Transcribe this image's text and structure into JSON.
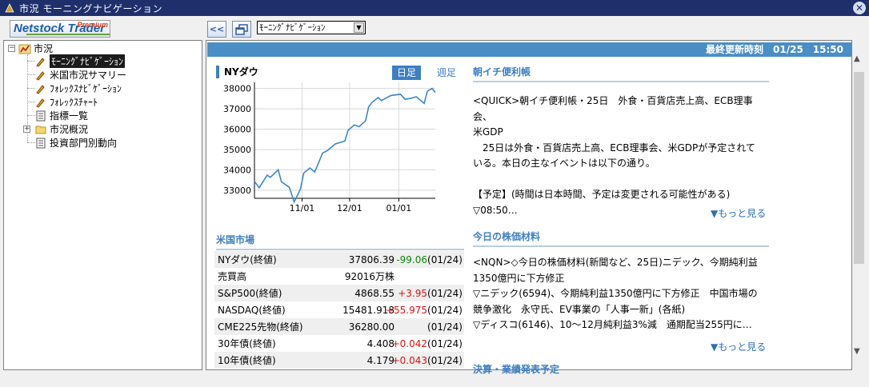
{
  "window": {
    "title": "市況 モーニングナビゲーション"
  },
  "logo": {
    "text": "Netstock Trader",
    "badge": "Premium"
  },
  "toolbar": {
    "back_label": "<<",
    "page_select": "ﾓｰﾆﾝｸﾞﾅﾋﾞｹﾞｰｼｮﾝ"
  },
  "tree": {
    "root": "市況",
    "items": [
      {
        "label": "ﾓｰﾆﾝｸﾞﾅﾋﾞｹﾞｰｼｮﾝ"
      },
      {
        "label": "米国市況サマリー"
      },
      {
        "label": "ﾌｫﾚｯｸｽﾅﾋﾞｹﾞｰｼｮﾝ"
      },
      {
        "label": "ﾌｫﾚｯｸｽﾁｬｰﾄ"
      },
      {
        "label": "指標一覧"
      },
      {
        "label": "市況概況"
      },
      {
        "label": "投資部門別動向"
      }
    ]
  },
  "header": {
    "label": "最終更新時刻",
    "date": "01/25",
    "time": "15:50"
  },
  "chart_panel": {
    "title": "NYダウ",
    "tab_day": "日足",
    "tab_week": "週足"
  },
  "chart_data": {
    "type": "line",
    "title": "NYダウ",
    "xlabel": "",
    "ylabel": "",
    "y_ticks": [
      "38000",
      "37000",
      "36000",
      "35000",
      "34000",
      "33000"
    ],
    "x_ticks": [
      "11/01",
      "12/01",
      "01/01"
    ],
    "ylim": [
      32600,
      38300
    ],
    "x_range": [
      "2023-10-02",
      "2024-01-24"
    ],
    "grid": true,
    "series": [
      {
        "values": [
          [
            "2023-10-02",
            33434
          ],
          [
            "2023-10-05",
            33120
          ],
          [
            "2023-10-10",
            33740
          ],
          [
            "2023-10-12",
            33630
          ],
          [
            "2023-10-17",
            33998
          ],
          [
            "2023-10-19",
            33415
          ],
          [
            "2023-10-24",
            33140
          ],
          [
            "2023-10-27",
            32418
          ],
          [
            "2023-10-31",
            33052
          ],
          [
            "2023-11-02",
            33840
          ],
          [
            "2023-11-06",
            34095
          ],
          [
            "2023-11-09",
            33890
          ],
          [
            "2023-11-14",
            34828
          ],
          [
            "2023-11-17",
            34947
          ],
          [
            "2023-11-22",
            35273
          ],
          [
            "2023-11-28",
            35416
          ],
          [
            "2023-11-30",
            35950
          ],
          [
            "2023-12-04",
            36204
          ],
          [
            "2023-12-07",
            36117
          ],
          [
            "2023-12-11",
            36404
          ],
          [
            "2023-12-13",
            37090
          ],
          [
            "2023-12-15",
            37305
          ],
          [
            "2023-12-19",
            37557
          ],
          [
            "2023-12-21",
            37404
          ],
          [
            "2023-12-27",
            37656
          ],
          [
            "2024-01-02",
            37715
          ],
          [
            "2024-01-05",
            37466
          ],
          [
            "2024-01-09",
            37525
          ],
          [
            "2024-01-12",
            37592
          ],
          [
            "2024-01-17",
            37266
          ],
          [
            "2024-01-19",
            37863
          ],
          [
            "2024-01-22",
            38001
          ],
          [
            "2024-01-24",
            37806
          ]
        ]
      }
    ]
  },
  "us_market": {
    "title": "米国市場",
    "rows": [
      {
        "name": "NYダウ(終値)",
        "value": "37806.39",
        "change": "-99.06",
        "dir": "down",
        "date": "(01/24)"
      },
      {
        "name": "売買高",
        "value": "92016万株",
        "change": "",
        "dir": "",
        "date": ""
      },
      {
        "name": "S&P500(終値)",
        "value": "4868.55",
        "change": "+3.95",
        "dir": "up",
        "date": "(01/24)"
      },
      {
        "name": "NASDAQ(終値)",
        "value": "15481.918",
        "change": "+55.975",
        "dir": "up",
        "date": "(01/24)"
      },
      {
        "name": "CME225先物(終値)",
        "value": "36280.00",
        "change": "",
        "dir": "",
        "date": "(01/24)"
      },
      {
        "name": "30年債(終値)",
        "value": "4.408",
        "change": "+0.042",
        "dir": "up",
        "date": "(01/24)"
      },
      {
        "name": "10年債(終値)",
        "value": "4.179",
        "change": "+0.043",
        "dir": "up",
        "date": "(01/24)"
      }
    ]
  },
  "news1": {
    "title": "朝イチ便利帳",
    "lines": [
      "<QUICK>朝イチ便利帳・25日　外食・百貨店売上高、ECB理事会、",
      "米GDP",
      "　25日は外食・百貨店売上高、ECB理事会、米GDPが予定されて",
      "いる。本日の主なイベントは以下の通り。",
      "",
      "【予定】(時間は日本時間、予定は変更される可能性がある)",
      "▽08:50…"
    ],
    "more": "▼もっと見る"
  },
  "news2": {
    "title": "今日の株価材料",
    "lines": [
      "<NQN>◇今日の株価材料(新聞など、25日)ニデック、今期純利益",
      "1350億円に下方修正",
      "▽ニデック(6594)、今期純利益1350億円に下方修正　中国市場の",
      "競争激化　永守氏、EV事業の「人事一新」(各紙)",
      "▽ディスコ(6146)、10～12月純利益3%減　通期配当255円に…"
    ],
    "more": "▼もっと見る"
  },
  "news3": {
    "title": "決算・業績発表予定"
  }
}
